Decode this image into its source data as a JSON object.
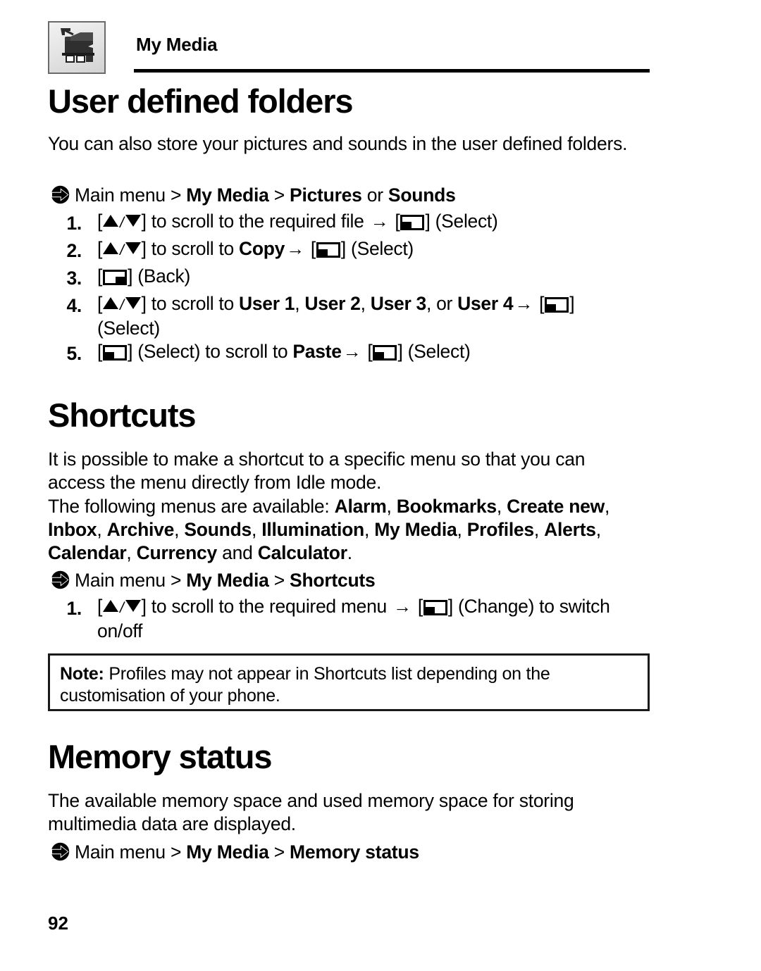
{
  "header": {
    "title": "My Media",
    "icon_name": "my-media-folder-icon"
  },
  "sections": {
    "user_defined_folders": {
      "heading": "User defined folders",
      "intro": "You can also store your pictures and sounds in the user defined folders.",
      "nav": {
        "prefix": "Main menu > ",
        "b1": "My Media",
        "sep1": " > ",
        "b2": "Pictures",
        "mid": " or ",
        "b3": "Sounds"
      },
      "steps": [
        {
          "num": "1.",
          "t1": " to scroll to the required file ",
          "t2": " (Select)"
        },
        {
          "num": "2.",
          "t1": " to scroll to ",
          "bold": "Copy",
          "t2": " (Select)"
        },
        {
          "num": "3.",
          "t2": " (Back)"
        },
        {
          "num": "4.",
          "t1": " to scroll to ",
          "b1": "User 1",
          "c1": ", ",
          "b2": "User 2",
          "c2": ", ",
          "b3": "User 3",
          "c3": ", or ",
          "b4": "User 4",
          "t2": "(Select)"
        },
        {
          "num": "5.",
          "t0": " (Select) to scroll to ",
          "bold": "Paste",
          "t2": " (Select)"
        }
      ]
    },
    "shortcuts": {
      "heading": "Shortcuts",
      "intro": "It is possible to make a shortcut to a specific menu so that you can access the menu directly from Idle mode.",
      "menus_lead": "The following menus are available: ",
      "menus": [
        "Alarm",
        "Bookmarks",
        "Create new",
        "Inbox",
        "Archive",
        "Sounds",
        "Illumination",
        "My Media",
        "Profiles",
        "Alerts",
        "Calendar",
        "Currency",
        "Calculator"
      ],
      "menus_conjunction": " and ",
      "menus_end": ".",
      "nav": {
        "prefix": "Main menu > ",
        "b1": "My Media",
        "sep1": " > ",
        "b2": "Shortcuts"
      },
      "steps": [
        {
          "num": "1.",
          "t1": " to scroll to the required menu ",
          "t2": " (Change) to switch on/off"
        }
      ],
      "note": {
        "label": "Note:",
        "text": " Profiles may not appear in Shortcuts list depending on the customisation of your phone."
      }
    },
    "memory_status": {
      "heading": "Memory status",
      "intro": "The available memory space and used memory space for storing multimedia data are displayed.",
      "nav": {
        "prefix": "Main menu > ",
        "b1": "My Media",
        "sep1": " > ",
        "b2": "Memory status"
      }
    }
  },
  "footer": {
    "page_number": "92"
  },
  "glyphs": {
    "softkey_select": "softkey-left-icon",
    "softkey_back": "softkey-right-icon",
    "up_arrow": "up-triangle-icon",
    "down_arrow": "down-triangle-icon",
    "right_arrow": "→",
    "nav_arrow": "nav-arrow-icon"
  }
}
